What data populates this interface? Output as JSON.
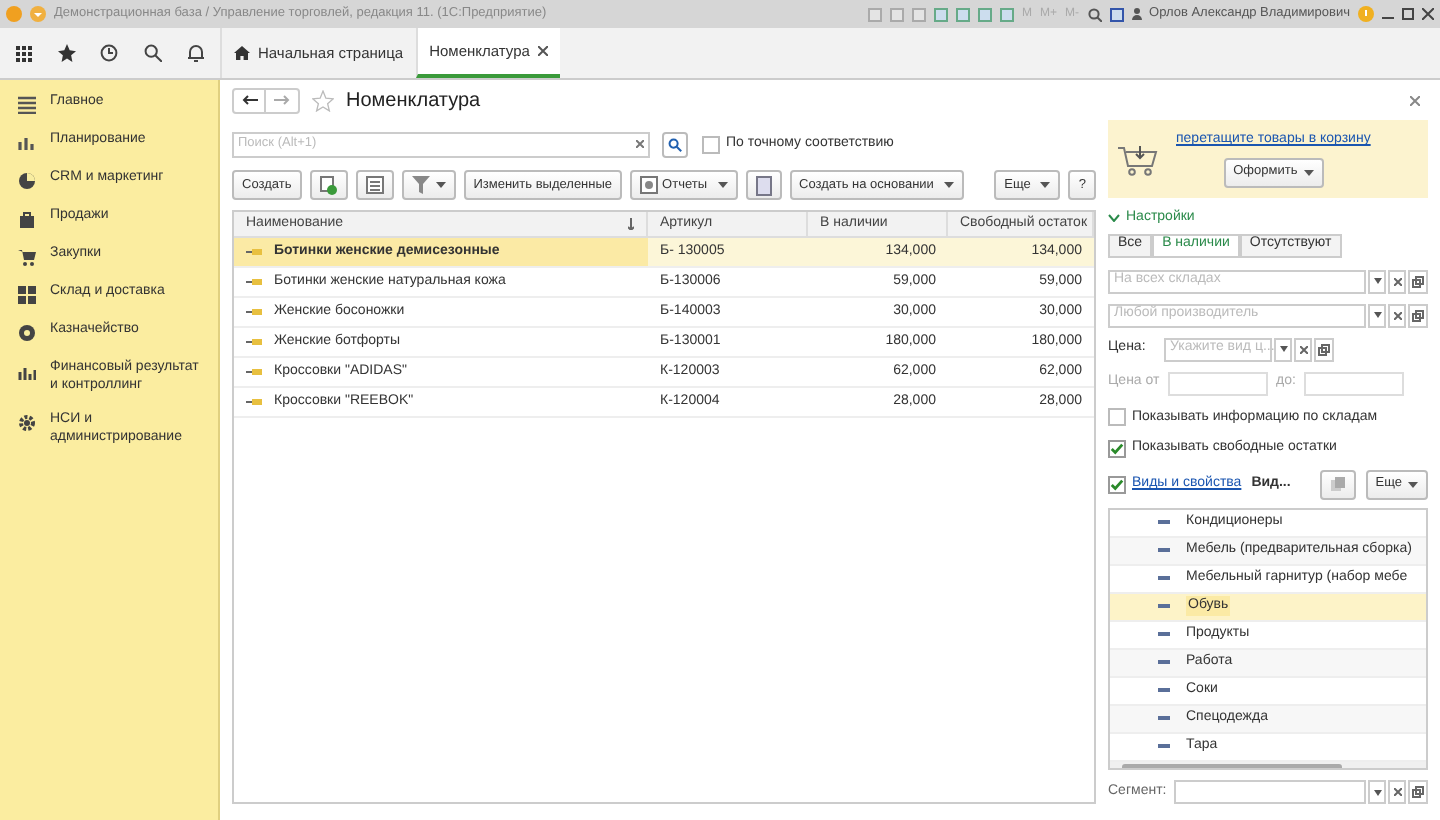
{
  "title_bar": {
    "title": "Демонстрационная база / Управление торговлей, редакция 11. (1С:Предприятие)",
    "memory_buttons": [
      "M",
      "M+",
      "M-"
    ],
    "user": "Орлов Александр Владимирович"
  },
  "tabs": [
    {
      "label": "Начальная страница",
      "selected": false,
      "kind": "home"
    },
    {
      "label": "Номенклатура",
      "selected": true,
      "kind": "page"
    }
  ],
  "sidebar": {
    "items": [
      {
        "label": "Главное"
      },
      {
        "label": "Планирование"
      },
      {
        "label": "CRM и маркетинг"
      },
      {
        "label": "Продажи"
      },
      {
        "label": "Закупки"
      },
      {
        "label": "Склад и доставка"
      },
      {
        "label": "Казначейство"
      },
      {
        "label": "Финансовый результат и контроллинг"
      },
      {
        "label": "НСИ и администрирование"
      }
    ]
  },
  "form": {
    "title": "Номенклатура",
    "search": {
      "placeholder": "Поиск (Alt+1)"
    },
    "exact_match": {
      "label": "По точному соответствию",
      "checked": false
    },
    "toolbar": [
      {
        "kind": "button",
        "label": "Создать",
        "dropdown": false
      },
      {
        "kind": "copy",
        "dropdown": false
      },
      {
        "kind": "list",
        "dropdown": false
      },
      {
        "kind": "filter",
        "dropdown": true
      },
      {
        "kind": "button",
        "label": "Изменить выделенные",
        "dropdown": false
      },
      {
        "kind": "report",
        "label": "Отчеты",
        "dropdown": true
      },
      {
        "kind": "doc",
        "dropdown": false
      },
      {
        "kind": "button",
        "label": "Создать на основании",
        "dropdown": true
      },
      {
        "kind": "spacer"
      },
      {
        "kind": "button",
        "label": "Еще",
        "dropdown": true
      },
      {
        "kind": "button",
        "label": "?",
        "dropdown": false
      }
    ],
    "table": {
      "columns": [
        "Наименование",
        "Артикул",
        "В наличии",
        "Свободный остаток"
      ],
      "rows": [
        {
          "name": "Ботинки женские демисезонные",
          "article": "Б- 130005",
          "in_stock": "134,000",
          "free": "134,000",
          "selected": true
        },
        {
          "name": "Ботинки женские натуральная кожа",
          "article": "Б-130006",
          "in_stock": "59,000",
          "free": "59,000",
          "selected": false
        },
        {
          "name": "Женские босоножки",
          "article": "Б-140003",
          "in_stock": "30,000",
          "free": "30,000",
          "selected": false
        },
        {
          "name": "Женские ботфорты",
          "article": "Б-130001",
          "in_stock": "180,000",
          "free": "180,000",
          "selected": false
        },
        {
          "name": "Кроссовки \"ADIDAS\"",
          "article": "К-120003",
          "in_stock": "62,000",
          "free": "62,000",
          "selected": false
        },
        {
          "name": "Кроссовки \"REEBOK\"",
          "article": "К-120004",
          "in_stock": "28,000",
          "free": "28,000",
          "selected": false
        }
      ]
    }
  },
  "panel": {
    "cart": {
      "link": "перетащите товары в корзину",
      "button": "Оформить"
    },
    "settings": {
      "label": "Настройки",
      "expanded": true
    },
    "filter_tabs": [
      {
        "label": "Все",
        "selected": false
      },
      {
        "label": "В наличии",
        "selected": true
      },
      {
        "label": "Отсутствуют",
        "selected": false
      }
    ],
    "warehouse": {
      "placeholder": "На всех складах"
    },
    "manufacturer": {
      "placeholder": "Любой производитель"
    },
    "price": {
      "label": "Цена:",
      "placeholder": "Укажите вид ц..."
    },
    "price_from": {
      "label": "Цена от"
    },
    "price_to": {
      "label": "до:"
    },
    "checkboxes": [
      {
        "label": "Показывать информацию по складам",
        "checked": false
      },
      {
        "label": "Показывать свободные остатки",
        "checked": true
      }
    ],
    "properties": {
      "checked": true,
      "link": "Виды и свойства",
      "label": "Вид...",
      "more": "Еще"
    },
    "categories": [
      {
        "label": "Кондиционеры",
        "selected": false
      },
      {
        "label": "Мебель (предварительная сборка)",
        "selected": false
      },
      {
        "label": "Мебельный гарнитур (набор мебе",
        "selected": false
      },
      {
        "label": "Обувь",
        "selected": true
      },
      {
        "label": "Продукты",
        "selected": false
      },
      {
        "label": "Работа",
        "selected": false
      },
      {
        "label": "Соки",
        "selected": false
      },
      {
        "label": "Спецодежда",
        "selected": false
      },
      {
        "label": "Тара",
        "selected": false
      }
    ],
    "segment": {
      "label": "Сегмент:"
    }
  }
}
